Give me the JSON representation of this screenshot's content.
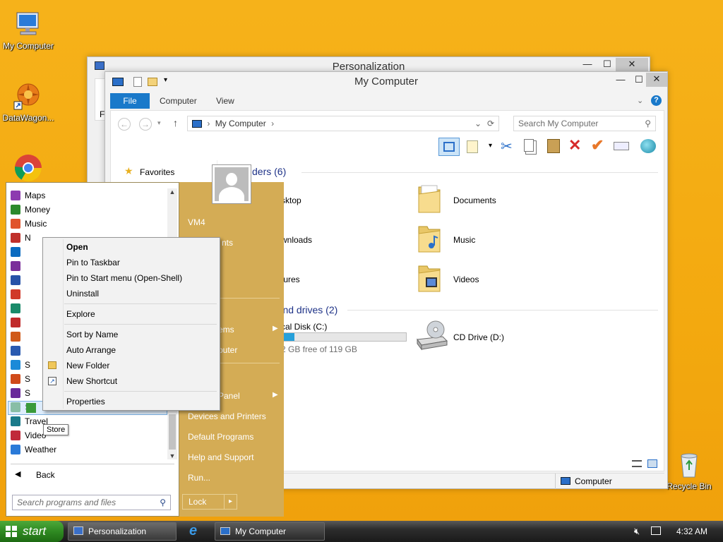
{
  "desktop": {
    "icons": [
      {
        "label": "My Computer"
      },
      {
        "label": "DataWagon..."
      },
      {
        "label": "Recycle Bin"
      }
    ]
  },
  "personalization_window": {
    "title": "Personalization",
    "partial_text": "Fi"
  },
  "explorer": {
    "title": "My Computer",
    "tabs": [
      "File",
      "Computer",
      "View"
    ],
    "address": "My Computer",
    "search_placeholder": "Search My Computer",
    "favorites_label": "Favorites",
    "folders_header": "ders (6)",
    "folders": [
      "sktop",
      "Documents",
      "wnloads",
      "Music",
      "tures",
      "Videos"
    ],
    "drives_header": "Devices and drives (2)",
    "drive_c": {
      "name": "cal Disk (C:)",
      "free": "2 GB free of 119 GB",
      "used_fraction": 0.1
    },
    "drive_d": {
      "name": "CD Drive (D:)"
    },
    "status_label": "Computer"
  },
  "start_menu": {
    "programs": [
      {
        "label": "Maps",
        "color": "#8d3bb0"
      },
      {
        "label": "Money",
        "color": "#2c8a2c"
      },
      {
        "label": "Music",
        "color": "#e0542c"
      },
      {
        "label": "N",
        "color": "#c0302a"
      },
      {
        "label": "",
        "color": "#0a6bc0"
      },
      {
        "label": "",
        "color": "#7a2e9a"
      },
      {
        "label": "",
        "color": "#2752a8"
      },
      {
        "label": "",
        "color": "#d03a2a"
      },
      {
        "label": "",
        "color": "#1a8a6a"
      },
      {
        "label": "",
        "color": "#c02a2a"
      },
      {
        "label": "",
        "color": "#d05a1a"
      },
      {
        "label": "",
        "color": "#2a5ab0"
      },
      {
        "label": "S",
        "color": "#1b8ad8"
      },
      {
        "label": "S",
        "color": "#d04a1a"
      },
      {
        "label": "S",
        "color": "#6a2a9a"
      },
      {
        "label": "S",
        "color": "#2a8a2a"
      },
      {
        "label": "Travel",
        "color": "#1a7a8a"
      },
      {
        "label": "Video",
        "color": "#c02a3a"
      },
      {
        "label": "Weather",
        "color": "#2a7ad8"
      }
    ],
    "tooltip": "Store",
    "back_label": "Back",
    "search_placeholder": "Search programs and files",
    "right_items": [
      "VM4",
      "nts",
      "ems",
      "puter",
      "Panel",
      "Devices and Printers",
      "Default Programs",
      "Help and Support",
      "Run..."
    ],
    "lock_label": "Lock"
  },
  "context_menu": {
    "items": [
      "Open",
      "Pin to Taskbar",
      "Pin to Start menu (Open-Shell)",
      "Uninstall",
      "Explore",
      "Sort by Name",
      "Auto Arrange",
      "New Folder",
      "New Shortcut",
      "Properties"
    ]
  },
  "taskbar": {
    "start_label": "start",
    "buttons": [
      "Personalization",
      "My Computer"
    ],
    "clock": "4:32 AM"
  }
}
